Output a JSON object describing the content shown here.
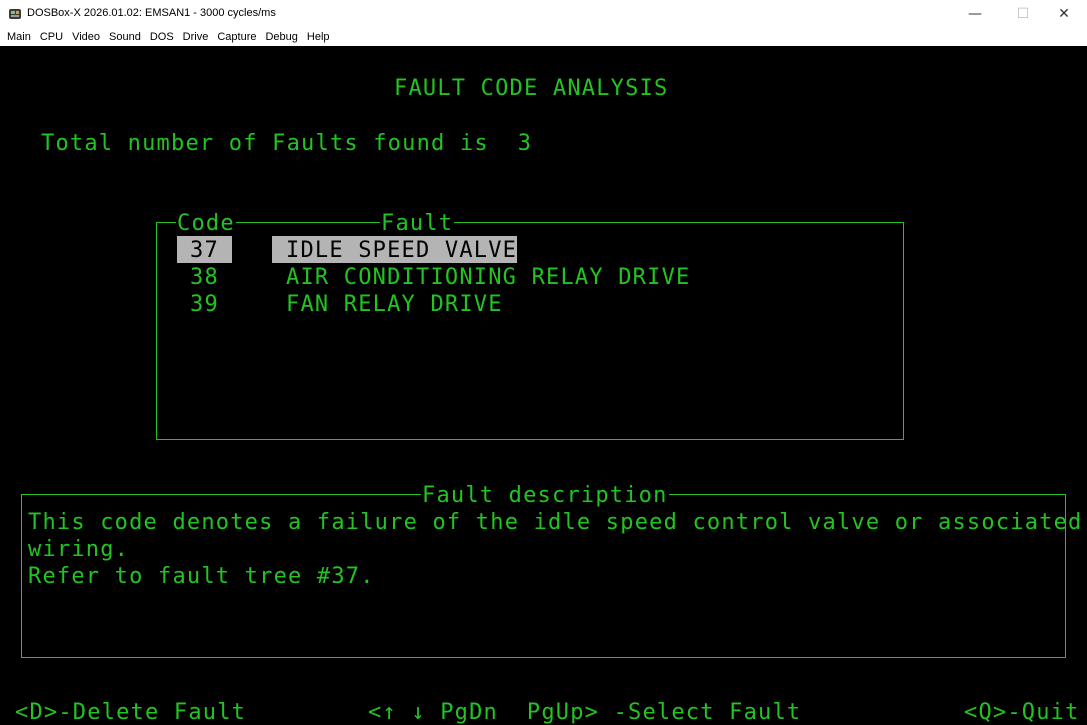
{
  "window": {
    "title": "DOSBox-X 2026.01.02: EMSAN1 - 3000 cycles/ms",
    "icon": "dosbox-app-icon",
    "minimize_glyph": "—",
    "maximize_glyph": "☐",
    "close_glyph": "✕"
  },
  "menubar": {
    "items": [
      "Main",
      "CPU",
      "Video",
      "Sound",
      "DOS",
      "Drive",
      "Capture",
      "Debug",
      "Help"
    ]
  },
  "screen": {
    "heading": "FAULT CODE ANALYSIS",
    "total_text": "Total number of Faults found is  3",
    "fault_table": {
      "header_code": "Code",
      "header_fault": "Fault",
      "rows": [
        {
          "code": "37",
          "fault": "IDLE SPEED VALVE",
          "selected": true
        },
        {
          "code": "38",
          "fault": "AIR CONDITIONING RELAY DRIVE",
          "selected": false
        },
        {
          "code": "39",
          "fault": "FAN RELAY DRIVE",
          "selected": false
        }
      ]
    },
    "description": {
      "title": "Fault description",
      "lines": [
        "This code denotes a failure of the idle speed control valve or associated",
        "wiring.",
        "Refer to fault tree #37."
      ]
    },
    "footer": {
      "delete": "<D>-Delete Fault",
      "select": "<↑ ↓ PgDn  PgUp> -Select Fault",
      "quit": "<Q>-Quit"
    },
    "colors": {
      "foreground": "#22c322",
      "background": "#000000",
      "highlight": "#b4b4b4"
    }
  }
}
